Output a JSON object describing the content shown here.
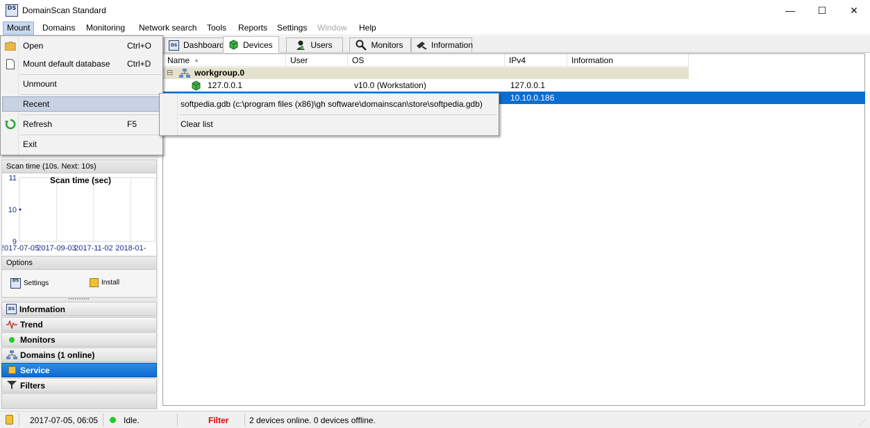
{
  "window": {
    "app_icon_text": "DS",
    "title": "DomainScan Standard",
    "minimize_glyph": "—",
    "maximize_glyph": "☐",
    "close_glyph": "✕"
  },
  "menubar": {
    "items": [
      {
        "label": "Mount",
        "state": "active"
      },
      {
        "label": "Domains"
      },
      {
        "label": "Monitoring"
      },
      {
        "label": "Network search"
      },
      {
        "label": "Tools"
      },
      {
        "label": "Reports"
      },
      {
        "label": "Settings"
      },
      {
        "label": "Window",
        "state": "disabled"
      },
      {
        "label": "Help"
      }
    ]
  },
  "mount_menu": {
    "items": [
      {
        "label": "Open",
        "shortcut": "Ctrl+O",
        "icon": "folder-icon"
      },
      {
        "label": "Mount default database",
        "shortcut": "Ctrl+D",
        "icon": "document-icon"
      },
      {
        "label": "Unmount",
        "shortcut": ""
      },
      {
        "label": "Recent",
        "shortcut": "",
        "highlighted": true
      },
      {
        "label": "Refresh",
        "shortcut": "F5",
        "icon": "refresh-icon"
      },
      {
        "label": "Exit",
        "shortcut": ""
      }
    ]
  },
  "recent_submenu": {
    "file": "softpedia.gdb (c:\\program files (x86)\\gh software\\domainscan\\store\\softpedia.gdb)",
    "clear": "Clear list"
  },
  "tabs": [
    {
      "label": "Dashboard",
      "icon": "ds-icon"
    },
    {
      "label": "Devices",
      "icon": "device-icon",
      "active": true
    },
    {
      "label": "Users",
      "icon": "user-icon"
    },
    {
      "label": "Monitors",
      "icon": "magnifier-icon"
    },
    {
      "label": "Information",
      "icon": "tools-icon"
    }
  ],
  "table": {
    "columns": [
      "Name",
      "User",
      "OS",
      "IPv4",
      "Information"
    ],
    "group": {
      "expander": "⊟",
      "name": "workgroup.0"
    },
    "rows": [
      {
        "name": "127.0.0.1",
        "user": "",
        "os": "v10.0 (Workstation)",
        "ipv4": "127.0.0.1",
        "info": ""
      },
      {
        "name": "",
        "user": "",
        "os": "",
        "ipv4": "10.10.0.186",
        "info": "",
        "selected": true
      }
    ]
  },
  "left_panel": {
    "scan_header": "Scan time (10s. Next: 10s)",
    "options_header": "Options",
    "options": [
      {
        "label": "Settings",
        "icon": "ds-icon"
      },
      {
        "label": "Install",
        "icon": "install-icon"
      }
    ],
    "grip": "••••••••••",
    "nav": [
      {
        "label": "Information",
        "icon": "ds-icon"
      },
      {
        "label": "Trend",
        "icon": "trend-icon"
      },
      {
        "label": "Monitors",
        "icon": "green-dot-icon"
      },
      {
        "label": "Domains (1 online)",
        "icon": "network-icon"
      },
      {
        "label": "Service",
        "icon": "service-icon",
        "selected": true
      },
      {
        "label": "Filters",
        "icon": "filter-icon"
      }
    ]
  },
  "chart_data": {
    "type": "line",
    "title": "Scan time (sec)",
    "xlabel": "",
    "ylabel": "",
    "x_ticks": [
      "2017-07-05",
      "2017-09-03",
      "2017-11-02",
      "2018-01-"
    ],
    "y_ticks": [
      9,
      10,
      11
    ],
    "ylim": [
      9,
      11
    ],
    "series": [
      {
        "values": [
          10
        ]
      }
    ],
    "grid": true
  },
  "statusbar": {
    "datetime": "2017-07-05, 06:05",
    "state": "Idle.",
    "filter": "Filter",
    "summary": "2 devices online. 0 devices offline.",
    "colors": {
      "filter": "#e00000",
      "online_dot": "#22cc22"
    }
  }
}
